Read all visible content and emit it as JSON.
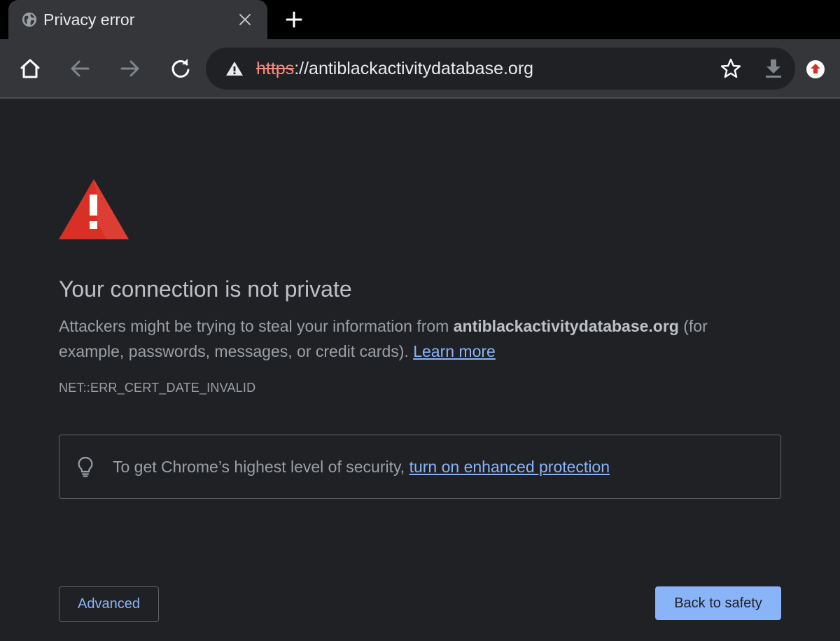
{
  "tab": {
    "title": "Privacy error",
    "favicon": "globe-icon",
    "close": "close-icon"
  },
  "new_tab": "plus-icon",
  "toolbar": {
    "home": "home-icon",
    "back": "arrow-left-icon",
    "forward": "arrow-right-icon",
    "reload": "reload-icon",
    "omnibox": {
      "warning": "warning-triangle-icon",
      "scheme": "https",
      "rest": "://antiblackactivitydatabase.org",
      "bookmark": "star-icon",
      "download": "download-icon"
    },
    "extension": "extension-upload-icon"
  },
  "interstitial": {
    "heading": "Your connection is not private",
    "explanation_pre": "Attackers might be trying to steal your information from ",
    "domain": "antiblackactivitydatabase.org",
    "explanation_post": " (for example, passwords, messages, or credit cards). ",
    "learn_more": "Learn more",
    "error_code": "NET::ERR_CERT_DATE_INVALID",
    "enhanced_text": "To get Chrome’s highest level of security, ",
    "enhanced_link": "turn on enhanced protection",
    "advanced_button": "Advanced",
    "safety_button": "Back to safety"
  },
  "colors": {
    "background": "#202124",
    "accent_blue": "#8ab4f8",
    "danger_red": "#d93025",
    "strike_red": "#f28b82"
  }
}
